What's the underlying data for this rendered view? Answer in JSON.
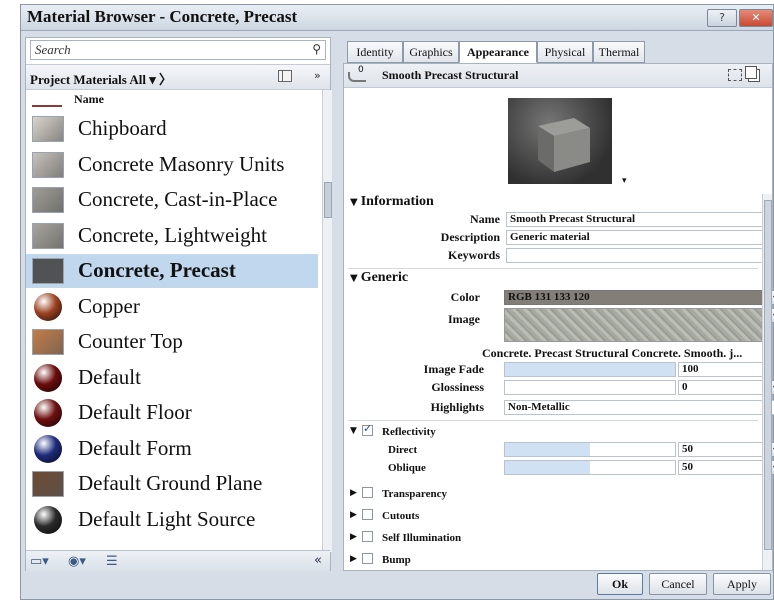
{
  "window": {
    "title": "Material Browser - Concrete, Precast",
    "help_label": "?",
    "close_label": "✕"
  },
  "left": {
    "search_placeholder": "Search",
    "project_label": "Project Materials All ▾ 〉",
    "collapse_label": "»",
    "column_name": "Name",
    "materials": [
      {
        "name": "Chipboard",
        "swatch": "#d9d4cc",
        "shape": "square"
      },
      {
        "name": "Concrete Masonry Units",
        "swatch": "#c6c2bc",
        "shape": "square"
      },
      {
        "name": "Concrete, Cast-in-Place",
        "swatch": "#9e9d98",
        "shape": "square"
      },
      {
        "name": "Concrete, Lightweight",
        "swatch": "#a8a59f",
        "shape": "square"
      },
      {
        "name": "Concrete, Precast",
        "swatch": "#4f5153",
        "shape": "square",
        "selected": true
      },
      {
        "name": "Copper",
        "swatch": "#9c4322",
        "shape": "sphere"
      },
      {
        "name": "Counter Top",
        "swatch": "#c47d48",
        "shape": "square"
      },
      {
        "name": "Default",
        "swatch": "#6c0c0c",
        "shape": "sphere"
      },
      {
        "name": "Default Floor",
        "swatch": "#6e1010",
        "shape": "sphere"
      },
      {
        "name": "Default Form",
        "swatch": "#1d2c7c",
        "shape": "sphere"
      },
      {
        "name": "Default Ground Plane",
        "swatch": "#6d4a33",
        "shape": "square"
      },
      {
        "name": "Default Light Source",
        "swatch": "#2b2b2b",
        "shape": "sphere"
      }
    ],
    "footer_collapse": "«"
  },
  "tabs": [
    {
      "label": "Identity",
      "active": false
    },
    {
      "label": "Graphics",
      "active": false
    },
    {
      "label": "Appearance",
      "active": true
    },
    {
      "label": "Physical",
      "active": false
    },
    {
      "label": "Thermal",
      "active": false
    }
  ],
  "right": {
    "count": "0",
    "material_name": "Smooth Precast Structural",
    "information": {
      "header": "Information",
      "name_label": "Name",
      "name_value": "Smooth Precast Structural",
      "description_label": "Description",
      "description_value": "Generic material",
      "keywords_label": "Keywords",
      "keywords_value": ""
    },
    "generic": {
      "header": "Generic",
      "color_label": "Color",
      "color_value": "RGB 131 133 120",
      "color_hex": "#837f78",
      "image_label": "Image",
      "image_filename": "Concrete. Precast Structural Concrete. Smooth. j...",
      "image_fade_label": "Image Fade",
      "image_fade_value": "100",
      "image_fade_fraction": 1.0,
      "glossiness_label": "Glossiness",
      "glossiness_value": "0",
      "glossiness_fraction": 0.0,
      "highlights_label": "Highlights",
      "highlights_value": "Non-Metallic"
    },
    "reflectivity": {
      "header": "Reflectivity",
      "checked": true,
      "direct_label": "Direct",
      "direct_value": "50",
      "direct_fraction": 0.5,
      "oblique_label": "Oblique",
      "oblique_value": "50",
      "oblique_fraction": 0.5
    },
    "collapsed_sections": [
      "Transparency",
      "Cutouts",
      "Self Illumination",
      "Bump"
    ]
  },
  "buttons": {
    "ok": "Ok",
    "cancel": "Cancel",
    "apply": "Apply"
  }
}
